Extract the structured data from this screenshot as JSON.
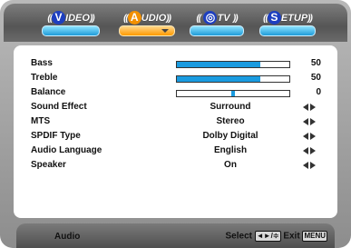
{
  "tabs": [
    {
      "letter": "V",
      "word": "IDEO",
      "active": false
    },
    {
      "letter": "A",
      "word": "UDIO",
      "active": true
    },
    {
      "letter": "◎",
      "word": "TV",
      "active": false
    },
    {
      "letter": "S",
      "word": "ETUP",
      "active": false
    }
  ],
  "tab_chevrons": {
    "left": "((",
    "right": "))"
  },
  "settings": {
    "bass": {
      "label": "Bass",
      "value": "50",
      "level": 0.74
    },
    "treble": {
      "label": "Treble",
      "value": "50",
      "level": 0.74
    },
    "balance": {
      "label": "Balance",
      "value": "0",
      "level": 0.5
    },
    "sound_effect": {
      "label": "Sound Effect",
      "value": "Surround"
    },
    "mts": {
      "label": "MTS",
      "value": "Stereo"
    },
    "spdif_type": {
      "label": "SPDIF Type",
      "value": "Dolby Digital"
    },
    "audio_language": {
      "label": "Audio Language",
      "value": "English"
    },
    "speaker": {
      "label": "Speaker",
      "value": "On"
    }
  },
  "footer": {
    "title": "Audio",
    "select_label": "Select",
    "select_key": "◄►/≑",
    "exit_label": "Exit",
    "exit_key": "MENU"
  },
  "colors": {
    "accent_blue": "#1a9be0",
    "active_orange": "#ff9a00",
    "letter_blue": "#1e3fbf"
  }
}
